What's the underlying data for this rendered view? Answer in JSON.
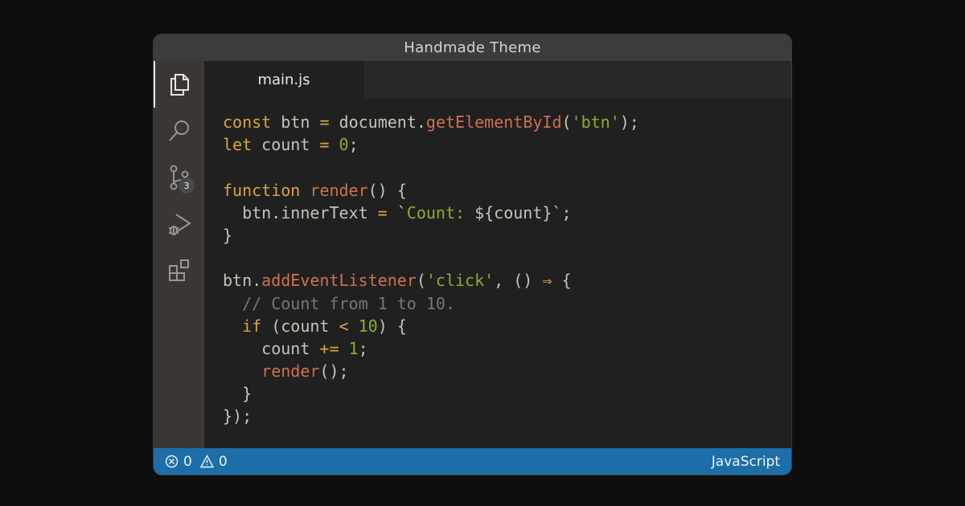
{
  "window": {
    "title": "Handmade Theme"
  },
  "activity_bar": {
    "items": [
      {
        "name": "explorer",
        "icon": "files-icon",
        "active": true
      },
      {
        "name": "search",
        "icon": "search-icon"
      },
      {
        "name": "source-control",
        "icon": "source-control-icon",
        "badge": "3"
      },
      {
        "name": "run-debug",
        "icon": "run-debug-icon"
      },
      {
        "name": "extensions",
        "icon": "extensions-icon"
      }
    ]
  },
  "tabs": [
    {
      "label": "main.js",
      "active": true
    }
  ],
  "code": {
    "lines": [
      [
        [
          "kw",
          "const"
        ],
        [
          "tx",
          " btn "
        ],
        [
          "op",
          "="
        ],
        [
          "tx",
          " document."
        ],
        [
          "fn",
          "getElementById"
        ],
        [
          "tx",
          "("
        ],
        [
          "str",
          "'btn'"
        ],
        [
          "tx",
          ");"
        ]
      ],
      [
        [
          "kw",
          "let"
        ],
        [
          "tx",
          " count "
        ],
        [
          "op",
          "="
        ],
        [
          "tx",
          " "
        ],
        [
          "num",
          "0"
        ],
        [
          "tx",
          ";"
        ]
      ],
      [],
      [
        [
          "kw",
          "function"
        ],
        [
          "tx",
          " "
        ],
        [
          "fn",
          "render"
        ],
        [
          "tx",
          "() {"
        ]
      ],
      [
        [
          "tx",
          "  btn.innerText "
        ],
        [
          "op",
          "="
        ],
        [
          "tx",
          " `"
        ],
        [
          "str",
          "Count: "
        ],
        [
          "tx",
          "${count}`;"
        ]
      ],
      [
        [
          "tx",
          "}"
        ]
      ],
      [],
      [
        [
          "tx",
          "btn."
        ],
        [
          "fn",
          "addEventListener"
        ],
        [
          "tx",
          "("
        ],
        [
          "str",
          "'click'"
        ],
        [
          "tx",
          ", () "
        ],
        [
          "op",
          "⇒"
        ],
        [
          "tx",
          " {"
        ]
      ],
      [
        [
          "cm",
          "  // Count from 1 to 10."
        ]
      ],
      [
        [
          "tx",
          "  "
        ],
        [
          "kw",
          "if"
        ],
        [
          "tx",
          " (count "
        ],
        [
          "op",
          "<"
        ],
        [
          "tx",
          " "
        ],
        [
          "num",
          "10"
        ],
        [
          "tx",
          ") {"
        ]
      ],
      [
        [
          "tx",
          "    count "
        ],
        [
          "op",
          "+="
        ],
        [
          "tx",
          " "
        ],
        [
          "num",
          "1"
        ],
        [
          "tx",
          ";"
        ]
      ],
      [
        [
          "tx",
          "    "
        ],
        [
          "fn",
          "render"
        ],
        [
          "tx",
          "();"
        ]
      ],
      [
        [
          "tx",
          "  }"
        ]
      ],
      [
        [
          "tx",
          "});"
        ]
      ]
    ]
  },
  "status_bar": {
    "errors": "0",
    "warnings": "0",
    "language": "JavaScript",
    "color": "#1d6ea8"
  }
}
